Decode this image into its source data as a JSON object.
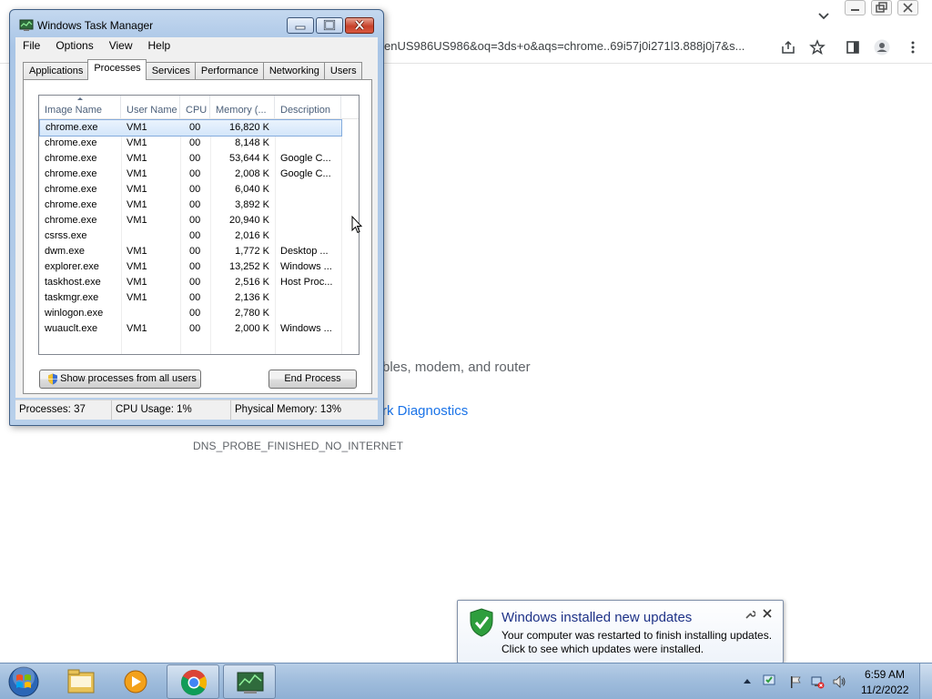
{
  "browser": {
    "address_text": "enUS986US986&oq=3ds+o&aqs=chrome..69i57j0i271l3.888j0j7&s...",
    "body": {
      "check_text": "bles, modem, and router",
      "diagnostics_link": "rk Diagnostics",
      "error_code": "DNS_PROBE_FINISHED_NO_INTERNET"
    }
  },
  "taskmgr": {
    "title": "Windows Task Manager",
    "menu": [
      "File",
      "Options",
      "View",
      "Help"
    ],
    "tabs": [
      "Applications",
      "Processes",
      "Services",
      "Performance",
      "Networking",
      "Users"
    ],
    "active_tab": "Processes",
    "columns": [
      "Image Name",
      "User Name",
      "CPU",
      "Memory (...",
      "Description"
    ],
    "processes": [
      {
        "image": "chrome.exe",
        "user": "VM1",
        "cpu": "00",
        "mem": "16,820 K",
        "desc": ""
      },
      {
        "image": "chrome.exe",
        "user": "VM1",
        "cpu": "00",
        "mem": "8,148 K",
        "desc": ""
      },
      {
        "image": "chrome.exe",
        "user": "VM1",
        "cpu": "00",
        "mem": "53,644 K",
        "desc": "Google C..."
      },
      {
        "image": "chrome.exe",
        "user": "VM1",
        "cpu": "00",
        "mem": "2,008 K",
        "desc": "Google C..."
      },
      {
        "image": "chrome.exe",
        "user": "VM1",
        "cpu": "00",
        "mem": "6,040 K",
        "desc": ""
      },
      {
        "image": "chrome.exe",
        "user": "VM1",
        "cpu": "00",
        "mem": "3,892 K",
        "desc": ""
      },
      {
        "image": "chrome.exe",
        "user": "VM1",
        "cpu": "00",
        "mem": "20,940 K",
        "desc": ""
      },
      {
        "image": "csrss.exe",
        "user": "",
        "cpu": "00",
        "mem": "2,016 K",
        "desc": ""
      },
      {
        "image": "dwm.exe",
        "user": "VM1",
        "cpu": "00",
        "mem": "1,772 K",
        "desc": "Desktop ..."
      },
      {
        "image": "explorer.exe",
        "user": "VM1",
        "cpu": "00",
        "mem": "13,252 K",
        "desc": "Windows ..."
      },
      {
        "image": "taskhost.exe",
        "user": "VM1",
        "cpu": "00",
        "mem": "2,516 K",
        "desc": "Host Proc..."
      },
      {
        "image": "taskmgr.exe",
        "user": "VM1",
        "cpu": "00",
        "mem": "2,136 K",
        "desc": ""
      },
      {
        "image": "winlogon.exe",
        "user": "",
        "cpu": "00",
        "mem": "2,780 K",
        "desc": ""
      },
      {
        "image": "wuauclt.exe",
        "user": "VM1",
        "cpu": "00",
        "mem": "2,000 K",
        "desc": "Windows ..."
      }
    ],
    "selected_index": 0,
    "show_all_label": "Show processes from all users",
    "end_process_label": "End Process",
    "status": {
      "processes": "Processes: 37",
      "cpu": "CPU Usage: 1%",
      "memory": "Physical Memory: 13%"
    }
  },
  "notification": {
    "title": "Windows installed new updates",
    "line1": "Your computer was restarted to finish installing updates.",
    "line2": "Click to see which updates were installed."
  },
  "taskbar": {
    "apps": [
      "start-orb-icon",
      "windows-explorer-icon",
      "media-player-icon",
      "chrome-icon",
      "task-manager-icon"
    ],
    "clock_time": "6:59 AM",
    "clock_date": "11/2/2022"
  },
  "colors": {
    "link": "#1a73e8",
    "taskbar": "#9fbcdc",
    "balloon_title": "#1e3287",
    "close_button": "#c7412b"
  }
}
